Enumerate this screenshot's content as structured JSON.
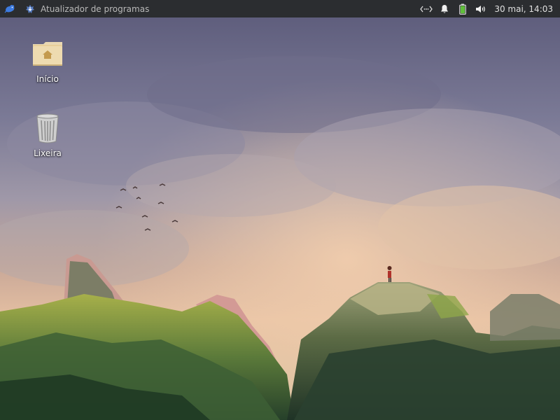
{
  "panel": {
    "menu_icon": "xfce-mouse-icon",
    "task": {
      "icon": "software-updater-icon",
      "label": "Atualizador de programas"
    },
    "tray": {
      "network_icon": "network-wired-icon",
      "notifications_icon": "bell-icon",
      "battery_icon": "battery-icon",
      "volume_icon": "speaker-icon"
    },
    "clock": "30 mai, 14:03"
  },
  "desktop": {
    "icons": [
      {
        "name": "home-folder",
        "icon": "home-folder-icon",
        "label": "Início"
      },
      {
        "name": "trash",
        "icon": "trash-icon",
        "label": "Lixeira"
      }
    ]
  },
  "colors": {
    "panel_bg": "#2b2d30",
    "panel_text": "#d4d4d4",
    "battery_fill": "#5fbf3a",
    "folder": "#e8cf9a"
  }
}
